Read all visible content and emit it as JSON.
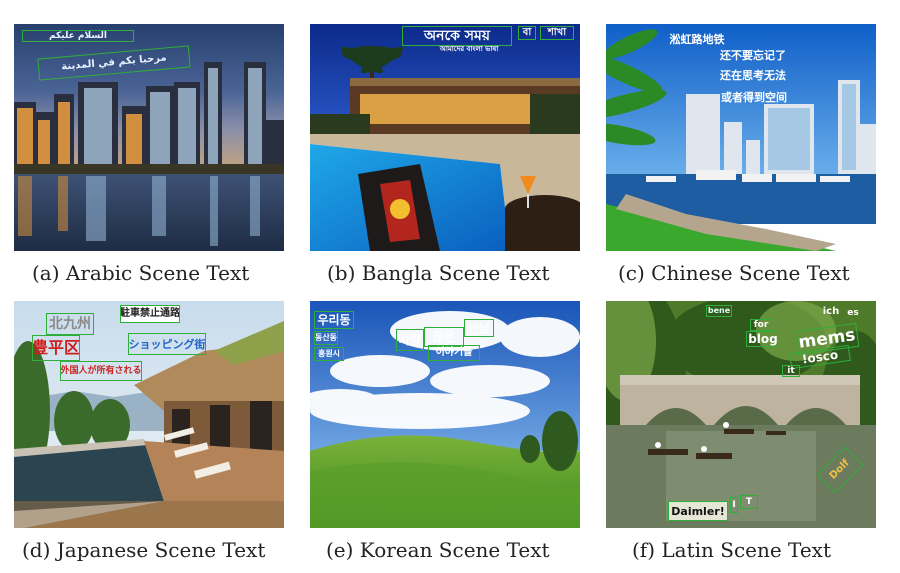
{
  "captions": {
    "a": "(a) Arabic Scene Text",
    "b": "(b) Bangla Scene Text",
    "c": "(c) Chinese Scene Text",
    "d": "(d) Japanese Scene Text",
    "e": "(e) Korean Scene Text",
    "f": "(f) Latin Scene Text"
  },
  "text": {
    "a": [
      "السلام عليكم",
      "مرحبا بكم في المدينة"
    ],
    "b": [
      "অনকে সময়",
      "বা",
      "শাখা",
      "আমাদের বাংলা ভাষা"
    ],
    "c": [
      "淞虹路地铁",
      "还不要忘记了",
      "还在思考无法",
      "或者得到空间"
    ],
    "d": [
      "北九州",
      "駐車禁止通路",
      "豊平区",
      "ショッピング街",
      "外国人が所有される"
    ],
    "e": [
      "우리동",
      "동산동",
      "홍원시",
      "사랑",
      "많은",
      "만남",
      "이야기들"
    ],
    "f": [
      "bene",
      "ich",
      "es",
      "for",
      "blog",
      "mems",
      "!osco",
      "it",
      "Daimler!",
      "I",
      "T",
      "Dolf"
    ]
  },
  "colors": {
    "box": "#2fae3a",
    "caption": "#222222"
  }
}
